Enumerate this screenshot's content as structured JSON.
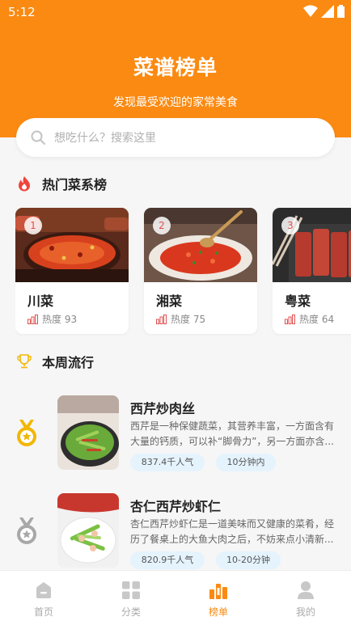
{
  "status": {
    "time": "5:12"
  },
  "header": {
    "title": "菜谱榜单",
    "subtitle": "发现最受欢迎的家常美食"
  },
  "search": {
    "placeholder": "想吃什么？搜索这里"
  },
  "sections": {
    "hot": "热门菜系榜",
    "weekly": "本周流行"
  },
  "cuisines": [
    {
      "rank": "1",
      "name": "川菜",
      "heat": "热度 93"
    },
    {
      "rank": "2",
      "name": "湘菜",
      "heat": "热度 75"
    },
    {
      "rank": "3",
      "name": "粤菜",
      "heat": "热度 64"
    }
  ],
  "weekly": [
    {
      "title": "西芹炒肉丝",
      "desc": "西芹是一种保健蔬菜，其营养丰富，一方面含有大量的钙质，可以补“脚骨力”，另一方面亦含...",
      "popularity": "837.4千人气",
      "time": "10分钟内"
    },
    {
      "title": "杏仁西芹炒虾仁",
      "desc": "杏仁西芹炒虾仁是一道美味而又健康的菜肴，经历了餐桌上的大鱼大肉之后，不妨来点小清新...",
      "popularity": "820.9千人气",
      "time": "10-20分钟"
    }
  ],
  "nav": [
    {
      "label": "首页"
    },
    {
      "label": "分类"
    },
    {
      "label": "榜单"
    },
    {
      "label": "我的"
    }
  ],
  "colors": {
    "accent": "#fb8a12",
    "tag_bg": "#e5f3fd",
    "gold": "#f2b705",
    "silver": "#a8a8a8"
  }
}
